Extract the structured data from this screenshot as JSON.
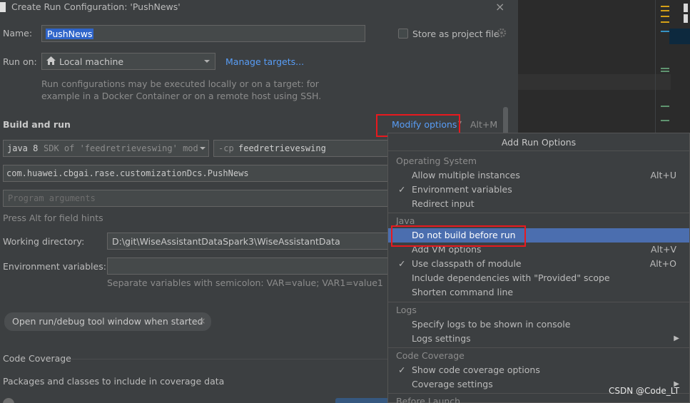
{
  "dialog": {
    "title": "Create Run Configuration: 'PushNews'",
    "close_glyph": "×",
    "name_label": "Name:",
    "name_value": "PushNews",
    "store_label": "Store as project file",
    "run_on_label": "Run on:",
    "run_on_value": "Local machine",
    "manage_targets": "Manage targets...",
    "run_on_hint_1": "Run configurations may be executed locally or on a target: for",
    "run_on_hint_2": "example in a Docker Container or on a remote host using SSH.",
    "build_and_run": "Build and run",
    "modify_options": "Modify options",
    "modify_shortcut": "Alt+M",
    "jdk_bold": "java 8",
    "jdk_rest": "SDK of 'feedretrieveswing' mod",
    "cp_flag": "-cp",
    "cp_value": "feedretrieveswing",
    "main_class": "com.huawei.cbgai.rase.customizationDcs.PushNews",
    "program_args_placeholder": "Program arguments",
    "alt_hint": "Press Alt for field hints",
    "workdir_label": "Working directory:",
    "workdir_value": "D:\\git\\WiseAssistantDataSpark3\\WiseAssistantData",
    "env_label": "Environment variables:",
    "env_hint": "Separate variables with semicolon: VAR=value; VAR1=value1",
    "chip_label": "Open run/debug tool window when started",
    "chip_close": "×",
    "code_coverage": "Code Coverage",
    "packages_label": "Packages and classes to include in coverage data"
  },
  "popup": {
    "title": "Add Run Options",
    "os_group": "Operating System",
    "os_items": [
      {
        "label": "Allow multiple instances",
        "shortcut": "Alt+U",
        "checked": ""
      },
      {
        "label": "Environment variables",
        "shortcut": "",
        "checked": "✓"
      },
      {
        "label": "Redirect input",
        "shortcut": "",
        "checked": ""
      }
    ],
    "java_group": "Java",
    "java_items": [
      {
        "label": "Do not build before run",
        "shortcut": "",
        "checked": ""
      },
      {
        "label": "Add VM options",
        "shortcut": "Alt+V",
        "checked": ""
      },
      {
        "label": "Use classpath of module",
        "shortcut": "Alt+O",
        "checked": "✓"
      },
      {
        "label": "Include dependencies with \"Provided\" scope",
        "shortcut": "",
        "checked": ""
      },
      {
        "label": "Shorten command line",
        "shortcut": "",
        "checked": ""
      }
    ],
    "logs_group": "Logs",
    "logs_items": [
      {
        "label": "Specify logs to be shown in console",
        "checked": ""
      },
      {
        "label": "Logs settings",
        "checked": "",
        "arrow": "▶"
      }
    ],
    "coverage_group": "Code Coverage",
    "coverage_items": [
      {
        "label": "Show code coverage options",
        "checked": "✓"
      },
      {
        "label": "Coverage settings",
        "checked": "",
        "arrow": "▶"
      }
    ],
    "before_launch_group": "Before Launch"
  },
  "watermark": "CSDN @Code_LT",
  "colors": {
    "accent": "#4b6eaf",
    "link": "#589df6",
    "highlight_box": "#e8191e"
  }
}
